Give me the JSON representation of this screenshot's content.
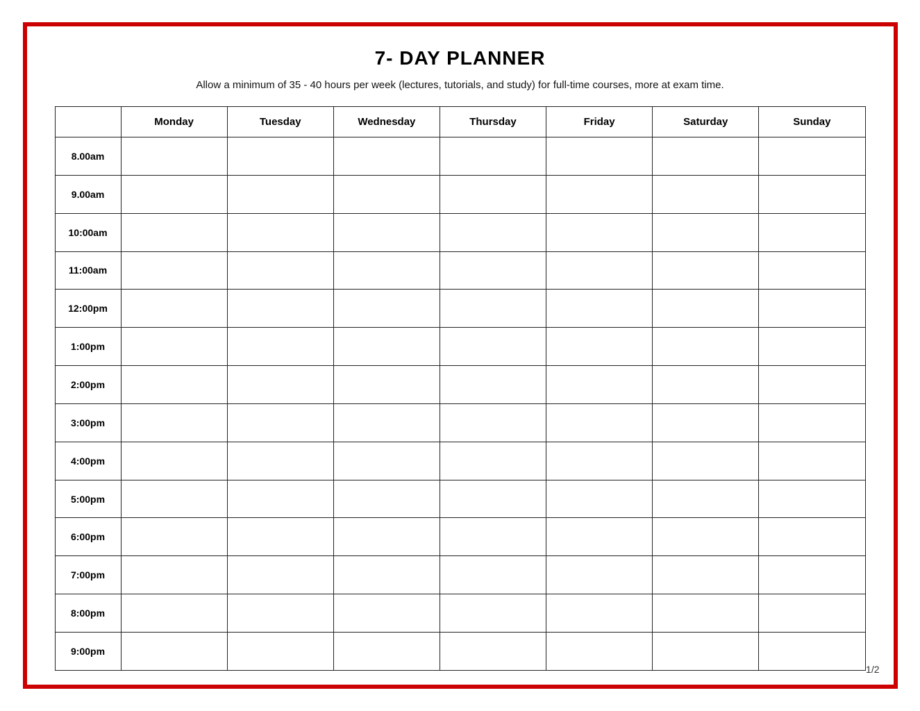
{
  "page": {
    "title": "7- DAY PLANNER",
    "subtitle": "Allow a minimum of 35 - 40 hours per week (lectures, tutorials, and study) for full-time courses, more at exam time.",
    "page_number": "1/2"
  },
  "table": {
    "headers": [
      "",
      "Monday",
      "Tuesday",
      "Wednesday",
      "Thursday",
      "Friday",
      "Saturday",
      "Sunday"
    ],
    "time_slots": [
      "8.00am",
      "9.00am",
      "10:00am",
      "11:00am",
      "12:00pm",
      "1:00pm",
      "2:00pm",
      "3:00pm",
      "4:00pm",
      "5:00pm",
      "6:00pm",
      "7:00pm",
      "8:00pm",
      "9:00pm"
    ]
  }
}
